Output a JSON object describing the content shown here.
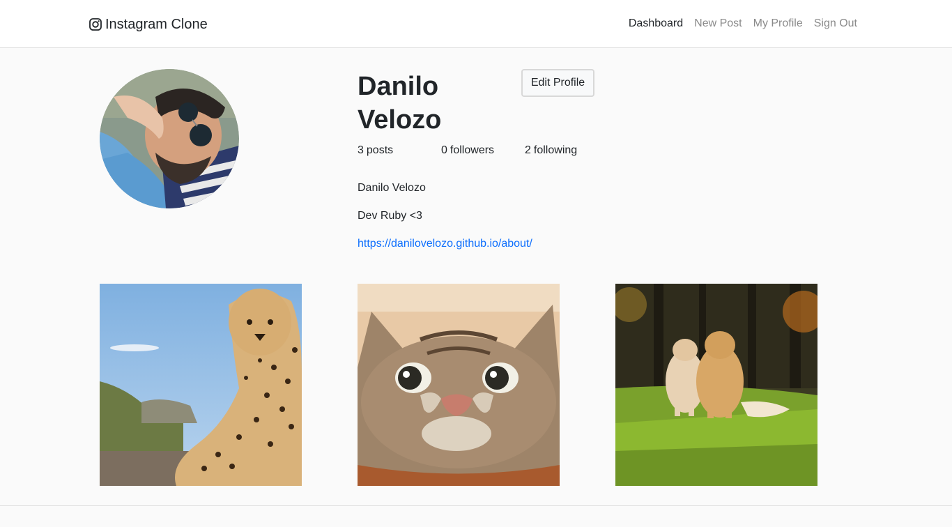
{
  "navbar": {
    "brand_icon": "instagram-icon",
    "brand": "Instagram Clone",
    "links": [
      {
        "label": "Dashboard",
        "active": true
      },
      {
        "label": "New Post",
        "active": false
      },
      {
        "label": "My Profile",
        "active": false
      },
      {
        "label": "Sign Out",
        "active": false
      }
    ]
  },
  "profile": {
    "name": "Danilo Velozo",
    "edit_button": "Edit Profile",
    "stats": [
      {
        "count": "3",
        "label": "posts"
      },
      {
        "count": "0",
        "label": "followers"
      },
      {
        "count": "2",
        "label": "following"
      }
    ],
    "bio_name": "Danilo Velozo",
    "bio_description": "Dev Ruby <3",
    "website": "https://danilovelozo.github.io/about/"
  },
  "posts": [
    {
      "subject": "cheetah"
    },
    {
      "subject": "cat"
    },
    {
      "subject": "dogs"
    }
  ],
  "colors": {
    "background": "#fafafa",
    "navbar": "#ffffff",
    "link": "#0d6efd",
    "nav_inactive": "#8a8a8a",
    "text": "#212529"
  }
}
